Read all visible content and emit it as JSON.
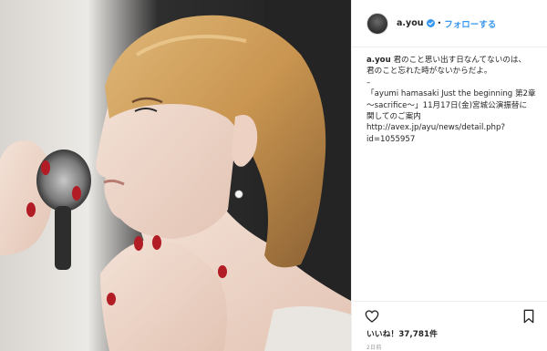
{
  "post": {
    "username": "a.you",
    "follow_label": "フォローする",
    "dot": "•",
    "caption": {
      "username": "a.you",
      "lines": [
        "君のこと思い出す日なんてないのは、",
        "君のこと忘れた時がないからだよ。",
        "–",
        "「ayumi hamasaki Just the beginning 第2章",
        "〜sacrifice〜」11月17日(金)宮城公演振替に",
        "関してのご案内",
        "http://avex.jp/ayu/news/detail.php?",
        "id=1055957"
      ]
    },
    "likes": "いいね！37,781件",
    "time": "2日前"
  },
  "icons": {
    "verified": "verified-badge-icon",
    "heart": "heart-icon",
    "bookmark": "bookmark-icon"
  },
  "colors": {
    "link": "#3897f0",
    "text": "#262626",
    "muted": "#999999",
    "border": "#efefef"
  }
}
